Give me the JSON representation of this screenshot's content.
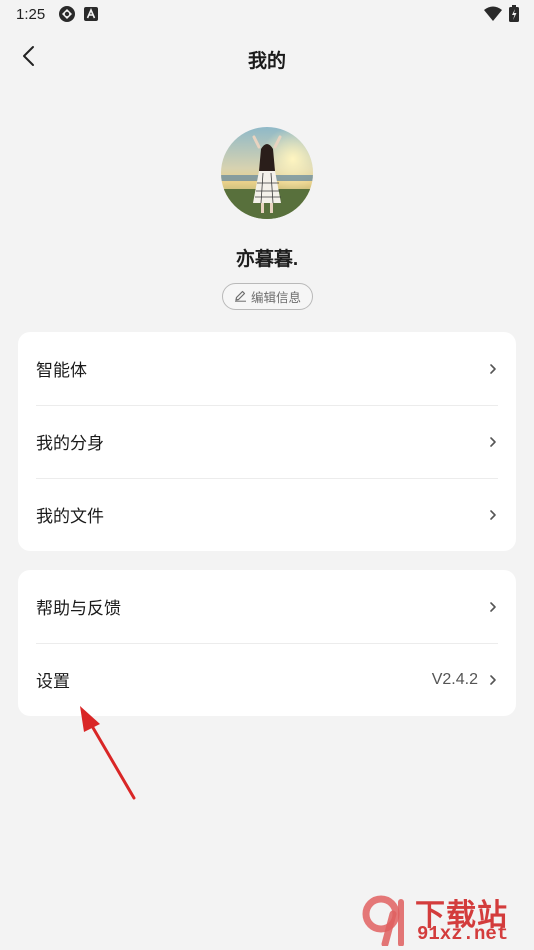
{
  "status_bar": {
    "time": "1:25"
  },
  "header": {
    "title": "我的"
  },
  "profile": {
    "username": "亦暮暮.",
    "edit_label": "编辑信息"
  },
  "menu_group_1": [
    {
      "label": "智能体",
      "value": ""
    },
    {
      "label": "我的分身",
      "value": ""
    },
    {
      "label": "我的文件",
      "value": ""
    }
  ],
  "menu_group_2": [
    {
      "label": "帮助与反馈",
      "value": ""
    },
    {
      "label": "设置",
      "value": "V2.4.2"
    }
  ],
  "watermark": {
    "line1": "下载站",
    "line2": "91xz.net"
  },
  "colors": {
    "background": "#f3f3f3",
    "card": "#ffffff",
    "annotation_arrow": "#d92626",
    "watermark": "#d33c3c"
  }
}
